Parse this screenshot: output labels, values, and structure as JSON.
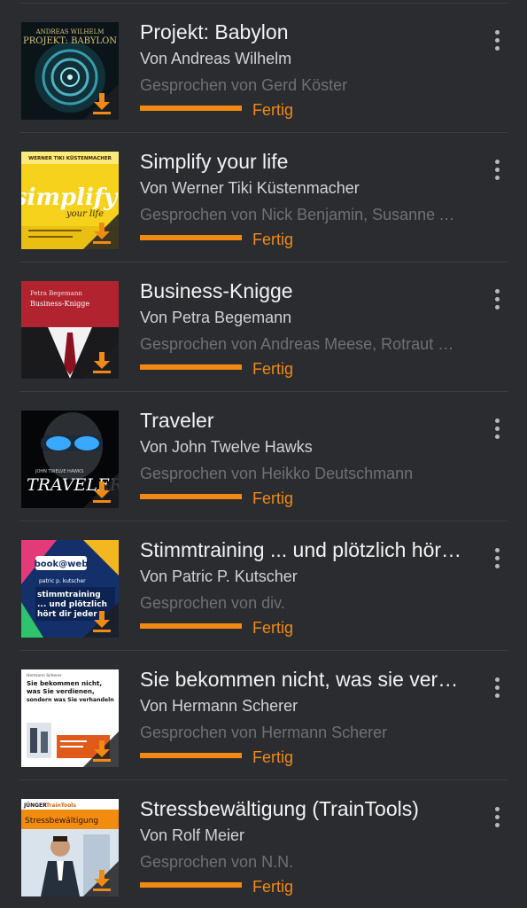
{
  "colors": {
    "background": "#2b2c30",
    "accent": "#f08a12",
    "title": "#f2f2f2",
    "author": "#d2d2d2",
    "narrator": "#6f7075"
  },
  "icons": {
    "download": "download-arrow-icon",
    "menu": "overflow-menu-icon"
  },
  "books": [
    {
      "title": "Projekt: Babylon",
      "author": "Von Andreas Wilhelm",
      "narrator": "Gesprochen von Gerd Köster",
      "status": "Fertig",
      "progress": 1.0,
      "cover_text": [
        "ANDREAS WILHELM",
        "PROJEKT: BABYLON"
      ]
    },
    {
      "title": "Simplify your life",
      "author": "Von Werner Tiki Küstenmacher",
      "narrator": "Gesprochen von Nick Benjamin, Susanne Aernecke",
      "status": "Fertig",
      "progress": 1.0,
      "cover_text": [
        "WERNER TIKI KÜSTENMACHER",
        "simplify",
        "your life"
      ]
    },
    {
      "title": "Business-Knigge",
      "author": "Von Petra Begemann",
      "narrator": "Gesprochen von Andreas Meese, Rotraut Rieger",
      "status": "Fertig",
      "progress": 1.0,
      "cover_text": [
        "Petra Begemann",
        "Business-Knigge"
      ]
    },
    {
      "title": "Traveler",
      "author": "Von John Twelve Hawks",
      "narrator": "Gesprochen von Heikko Deutschmann",
      "status": "Fertig",
      "progress": 1.0,
      "cover_text": [
        "JOHN TWELVE HAWKS",
        "TRAVELER"
      ]
    },
    {
      "title": "Stimmtraining ... und plötzlich hört dir jeder zu",
      "author": "Von Patric P. Kutscher",
      "narrator": "Gesprochen von div.",
      "status": "Fertig",
      "progress": 1.0,
      "cover_text": [
        "book@web",
        "patric p. kutscher",
        "stimmtraining",
        "... und plötzlich",
        "hört dir jeder"
      ]
    },
    {
      "title": "Sie bekommen nicht, was sie verdienen, sondern was Sie verhandeln",
      "author": "Von Hermann Scherer",
      "narrator": "Gesprochen von Hermann Scherer",
      "status": "Fertig",
      "progress": 1.0,
      "cover_text": [
        "Hermann Scherer",
        "Sie bekommen nicht,",
        "was Sie verdienen,",
        "sondern was Sie verhandeln"
      ]
    },
    {
      "title": "Stressbewältigung (TrainTools)",
      "author": "Von Rolf Meier",
      "narrator": "Gesprochen von N.N.",
      "status": "Fertig",
      "progress": 1.0,
      "cover_text": [
        "JÜNGER",
        "TrainTools",
        "Stressbewältigung"
      ]
    }
  ]
}
